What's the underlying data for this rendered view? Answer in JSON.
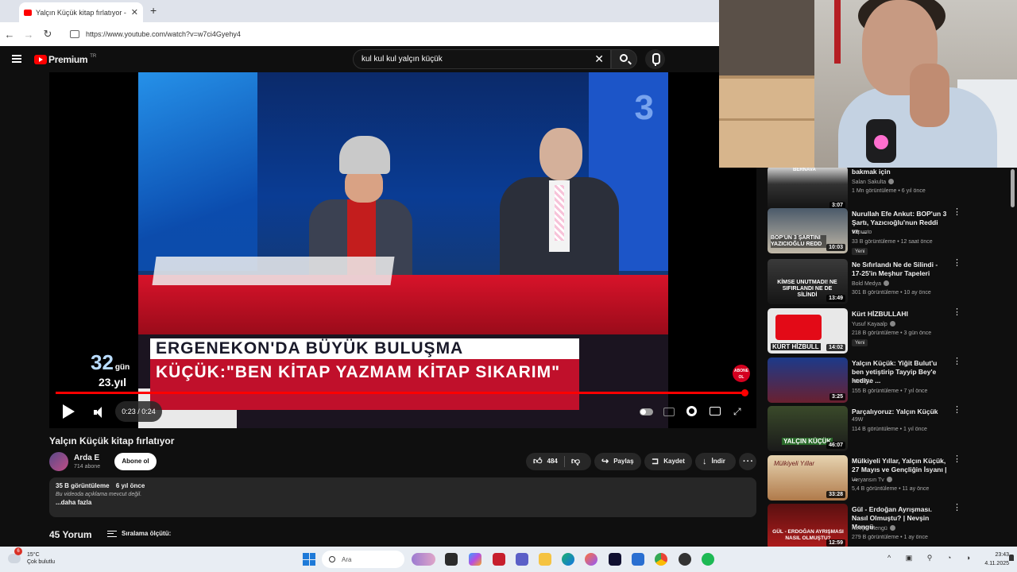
{
  "browser": {
    "tab_title": "Yalçın Küçük kitap fırlatıyor - Yo",
    "url": "https://www.youtube.com/watch?v=w7ci4Gyehy4"
  },
  "header": {
    "logo_text": "Premium",
    "region": "TR",
    "search_query": "kul kul kul yalçın küçük"
  },
  "video": {
    "lowerthird_line1": "ERGENEKON'DA BÜYÜK BULUŞMA",
    "lowerthird_line2": "KÜÇÜK:\"BEN KİTAP YAZMAM KİTAP SIKARIM\"",
    "badge_number": "32",
    "badge_unit": "gün",
    "badge_year": "23.yıl",
    "abone_badge": "ABONE OL",
    "time": "0:23 / 0:24",
    "progress": 0.99
  },
  "details": {
    "title": "Yalçın Küçük kitap fırlatıyor",
    "channel_name": "Arda E",
    "channel_subs": "714 abone",
    "subscribe_label": "Abone ol",
    "likes": "484",
    "share_label": "Paylaş",
    "save_label": "Kaydet",
    "download_label": "İndir",
    "views": "35 B görüntüleme",
    "age": "6 yıl önce",
    "description": "Bu videoda açıklama mevcut değil.",
    "more_label": "...daha fazla",
    "comments_count": "45 Yorum",
    "sort_label": "Sıralama ölçütü:"
  },
  "sidebar": {
    "items": [
      {
        "title": "bakmak için",
        "channel": "Salan Sakulta",
        "meta": "1 Mn görüntüleme • 6 yıl önce",
        "duration": "3:07",
        "thumb_text": "BERNAVA",
        "new": ""
      },
      {
        "title": "Nurullah Efe Ankut: BOP'un 3 Şartı, Yazıcıoğlu'nun Reddi ve ...",
        "channel": "12punto",
        "meta": "33 B görüntüleme • 12 saat önce",
        "duration": "10:03",
        "thumb_text": "BOP'UN 3 ŞARTINI YAZICIOĞLU REDD",
        "new": "Yeni"
      },
      {
        "title": "Ne Sıfırlandı Ne de Silindi - 17-25'in Meşhur Tapeleri",
        "channel": "Bold Medya",
        "meta": "301 B görüntüleme • 10 ay önce",
        "duration": "13:49",
        "thumb_text": "KİMSE UNUTMADI! NE SIFIRLANDI NE DE SİLİNDİ",
        "new": ""
      },
      {
        "title": "Kürt HİZBULLAHI",
        "channel": "Yusuf Kayaalp",
        "meta": "218 B görüntüleme • 3 gün önce",
        "duration": "14:02",
        "thumb_text": "KÜRT HİZBULL",
        "new": "Yeni"
      },
      {
        "title": "Yalçın Küçük: Yiğit Bulut'u ben yetiştirip Tayyip Bey'e hediye ...",
        "channel": "KRT TV",
        "meta": "155 B görüntüleme • 7 yıl önce",
        "duration": "3:25",
        "thumb_text": "",
        "new": ""
      },
      {
        "title": "Parçalıyoruz: Yalçın Küçük",
        "channel": "49W",
        "meta": "114 B görüntüleme • 1 yıl önce",
        "duration": "46:07",
        "thumb_text": "YALÇIN KÜÇÜK",
        "new": ""
      },
      {
        "title": "Mülkiyeli Yıllar, Yalçın Küçük, 27 Mayıs ve Gençliğin İsyanı | ...",
        "channel": "Veryansın Tv",
        "meta": "5,4 B görüntüleme • 11 ay önce",
        "duration": "33:28",
        "thumb_text": "Mülkiyeli Yıllar",
        "new": ""
      },
      {
        "title": "Gül - Erdoğan Ayrışması. Nasıl Olmuştu? | Nevşin Mengü",
        "channel": "Nevşin Mengü",
        "meta": "279 B görüntüleme • 1 ay önce",
        "duration": "12:59",
        "thumb_text": "GÜL - ERDOĞAN AYRIŞMASI NASIL OLMUŞTU?",
        "new": ""
      }
    ]
  },
  "taskbar": {
    "temperature": "15°C",
    "weather": "Çok bulutlu",
    "weather_badge": "6",
    "search_placeholder": "Ara",
    "time": "23:43",
    "date": "4.11.2025"
  }
}
